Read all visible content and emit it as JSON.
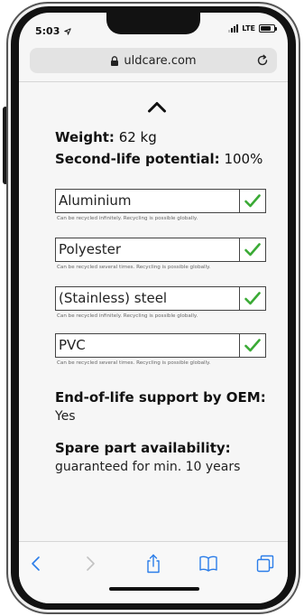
{
  "status_bar": {
    "time": "5:03",
    "location_icon": "location-arrow-icon",
    "network": "LTE",
    "signal_icon": "signal-bars-icon",
    "battery_icon": "battery-icon"
  },
  "browser": {
    "url": "uldcare.com",
    "lock_icon": "lock-icon",
    "reload_icon": "reload-icon"
  },
  "page": {
    "collapse_icon": "chevron-up-icon",
    "weight_label": "Weight:",
    "weight_value": "62 kg",
    "potential_label": "Second-life potential:",
    "potential_value": "100%",
    "materials": [
      {
        "name": "Aluminium",
        "note": "Can be recycled infinitely. Recycling is possible globally.",
        "check_icon": "check-icon"
      },
      {
        "name": "Polyester",
        "note": "Can be recycled several times. Recycling is possible globally.",
        "check_icon": "check-icon"
      },
      {
        "name": "(Stainless) steel",
        "note": "Can be recycled infinitely. Recycling is possible globally.",
        "check_icon": "check-icon"
      },
      {
        "name": "PVC",
        "note": "Can be recycled several times. Recycling is possible globally.",
        "check_icon": "check-icon"
      }
    ],
    "eol_heading": "End-of-life support by OEM:",
    "eol_value": "Yes",
    "spare_heading": "Spare part availability:",
    "spare_value": "guaranteed for min. 10 years"
  },
  "toolbar": {
    "back_icon": "back-arrow-icon",
    "forward_icon": "forward-arrow-icon",
    "share_icon": "share-icon",
    "bookmarks_icon": "bookmarks-icon",
    "tabs_icon": "tabs-icon"
  },
  "colors": {
    "check": "#3aaa35",
    "toolbar_icon": "#2b7de9",
    "toolbar_icon_disabled": "#c2c2c2"
  }
}
